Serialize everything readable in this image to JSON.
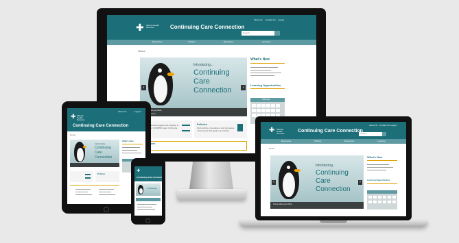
{
  "site": {
    "org": "Alberta Health Services",
    "title": "Continuing Care Connection",
    "breadcrumb": "Home"
  },
  "top_links": [
    "About Us",
    "Contact Us",
    "Logout"
  ],
  "search": {
    "placeholder": "Search"
  },
  "nav": [
    "Resources",
    "Policies",
    "Resources",
    "Learning"
  ],
  "slider": {
    "kicker": "Introducing...",
    "headline_lines": [
      "Continuing",
      "Care",
      "Connection"
    ],
    "caption": "Know what you think",
    "caption_sub": "Listen to listen"
  },
  "sidebar": {
    "whats_new": "What's New",
    "learning": "Learning Opportunities",
    "calendar_month": "February"
  },
  "tiles": {
    "policies_title": "Policies",
    "policies_text": "Find policies, procedures, and processes / documents that guide our practice.",
    "support_text": "Find and support the practice of our CCSP/RC team in this site.",
    "resources_title": "Resources"
  },
  "colors": {
    "brand_teal": "#1c6f78",
    "nav_teal": "#5e9aa1",
    "accent_gold": "#e0a100"
  },
  "icons": [
    "arrow-left-icon",
    "arrow-right-icon",
    "search-icon",
    "list-icon",
    "document-icon",
    "penguin-illustration"
  ]
}
